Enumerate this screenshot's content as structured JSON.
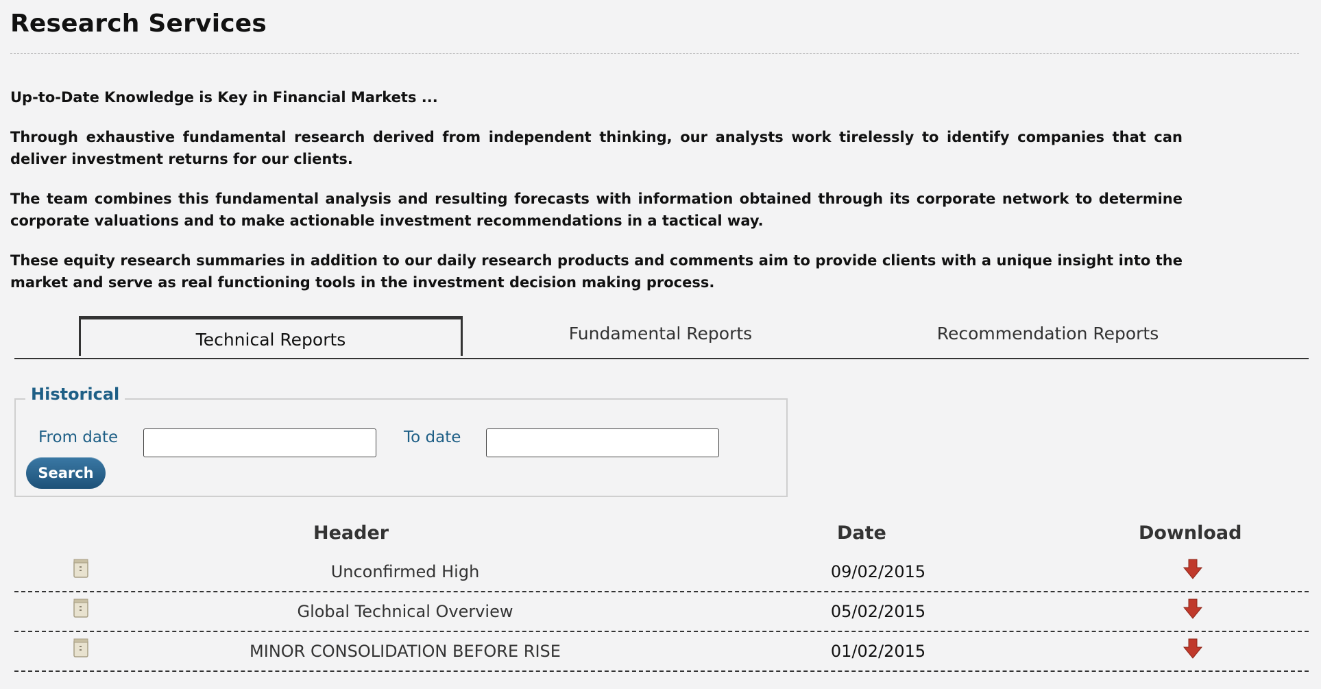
{
  "page": {
    "title": "Research Services"
  },
  "intro": {
    "lead": "Up-to-Date Knowledge is Key in Financial Markets ...",
    "p1": "Through exhaustive fundamental research derived from independent thinking, our analysts work tirelessly to identify companies that can deliver investment returns for our clients.",
    "p2": "The team combines this fundamental analysis and resulting forecasts with information obtained through its corporate network to determine corporate valuations and to make actionable investment recommendations in a tactical way.",
    "p3": "These equity research summaries in addition to our daily research products and comments aim to provide clients with a unique insight into the market and serve as real functioning tools in the investment decision making process."
  },
  "tabs": [
    {
      "label": "Technical Reports",
      "active": true
    },
    {
      "label": "Fundamental Reports",
      "active": false
    },
    {
      "label": "Recommendation Reports",
      "active": false
    }
  ],
  "historical": {
    "legend": "Historical",
    "from_label": "From date",
    "from_value": "",
    "to_label": "To date",
    "to_value": "",
    "search_label": "Search"
  },
  "table": {
    "columns": {
      "header": "Header",
      "date": "Date",
      "download": "Download"
    },
    "rows": [
      {
        "header": "Unconfirmed High",
        "date": "09/02/2015"
      },
      {
        "header": "Global Technical Overview",
        "date": "05/02/2015"
      },
      {
        "header": "MINOR CONSOLIDATION BEFORE RISE",
        "date": "01/02/2015"
      }
    ]
  },
  "icons": {
    "document": "document-icon",
    "download": "download-arrow-icon"
  },
  "colors": {
    "accent_blue": "#1e5f86",
    "download_red": "#c0392b",
    "background": "#f3f3f4"
  }
}
